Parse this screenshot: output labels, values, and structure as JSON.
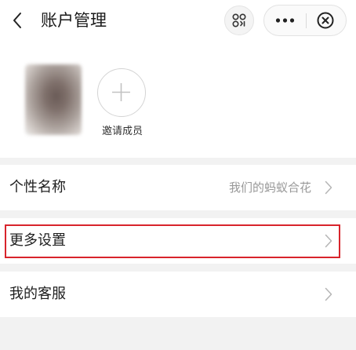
{
  "header": {
    "title": "账户管理",
    "back_icon": "chevron-left-icon",
    "qr_icon": "qr-code-icon",
    "more_icon": "more-dots-icon",
    "close_icon": "close-circle-icon"
  },
  "members": {
    "invite_label": "邀请成员",
    "invite_icon": "plus-icon"
  },
  "rows": [
    {
      "label": "个性名称",
      "value": "我们的蚂蚁合花"
    },
    {
      "label": "更多设置",
      "value": ""
    },
    {
      "label": "我的客服",
      "value": ""
    }
  ],
  "colors": {
    "background": "#f2f2f2",
    "panel": "#ffffff",
    "highlight_border": "#d8242c",
    "secondary_text": "#999999"
  }
}
